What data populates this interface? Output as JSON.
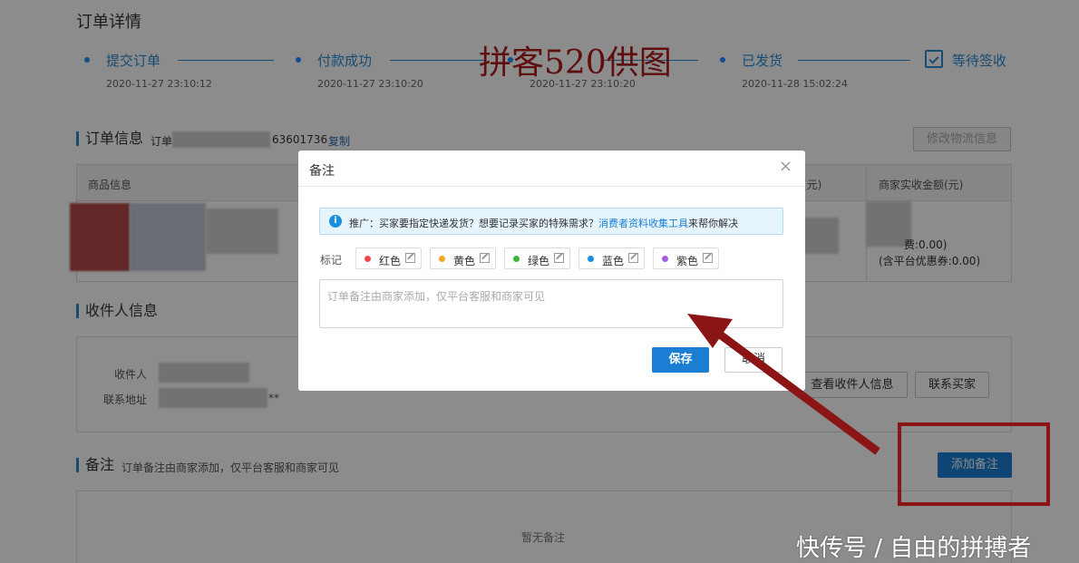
{
  "page_title": "订单详情",
  "steps": [
    {
      "label": "提交订单",
      "time": "2020-11-27 23:10:12"
    },
    {
      "label": "付款成功",
      "time": "2020-11-27 23:10:20"
    },
    {
      "label": "",
      "time": "2020-11-27 23:10:20"
    },
    {
      "label": "已发货",
      "time": "2020-11-28 15:02:24"
    },
    {
      "label": "等待签收",
      "time": ""
    }
  ],
  "watermark_top": "拼客520供图",
  "order_info": {
    "title": "订单信息",
    "id_label": "订单",
    "id_tail": "63601736",
    "copy": "复制",
    "modify_logistics": "修改物流信息"
  },
  "table": {
    "headers": [
      "商品信息",
      "(元)",
      "商家实收金额(元)"
    ],
    "fee_line": "费:0.00)",
    "coupon_line": "(含平台优惠券:0.00)"
  },
  "recipient": {
    "title": "收件人信息",
    "name_label": "收件人",
    "address_label": "联系地址",
    "address_tail": "**",
    "view_btn": "查看收件人信息",
    "contact_btn": "联系买家"
  },
  "remarks": {
    "title": "备注",
    "hint": "订单备注由商家添加，仅平台客服和商家可见",
    "add_btn": "添加备注",
    "empty": "暂无备注"
  },
  "modal": {
    "title": "备注",
    "close": "×",
    "notice_prefix": "推广：买家要指定快递发货？想要记录买家的特殊需求？",
    "notice_link": "消费者资料收集工具",
    "notice_suffix": "来帮你解决",
    "tag_label": "标记",
    "tags": [
      {
        "name": "红色",
        "color": "#f04848"
      },
      {
        "name": "黄色",
        "color": "#f5a623"
      },
      {
        "name": "绿色",
        "color": "#3ab53a"
      },
      {
        "name": "蓝色",
        "color": "#1a8ee0"
      },
      {
        "name": "紫色",
        "color": "#a35be0"
      }
    ],
    "placeholder": "订单备注由商家添加，仅平台客服和商家可见",
    "save": "保存",
    "cancel": "取消"
  },
  "watermark_bottom": "快传号 / 自由的拼搏者"
}
